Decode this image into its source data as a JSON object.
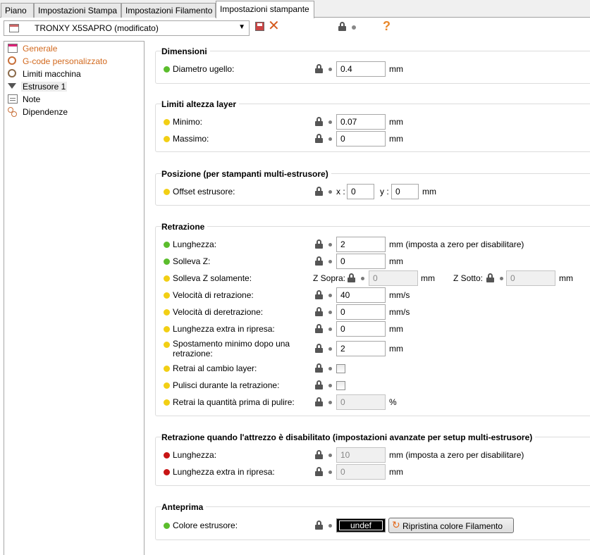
{
  "tabs": [
    "Piano",
    "Impostazioni Stampa",
    "Impostazioni Filamento",
    "Impostazioni stampante"
  ],
  "preset": "TRONXY X5SAPRO (modificato)",
  "toolbar": {
    "save_icon": "save-icon",
    "delete_icon": "delete-icon",
    "help_label": "?"
  },
  "tree": [
    {
      "label": "Generale",
      "icon": "page-icon",
      "color": "#d2691e"
    },
    {
      "label": "G-code personalizzato",
      "icon": "gear-icon",
      "color": "#d2691e"
    },
    {
      "label": "Limiti macchina",
      "icon": "gear-icon",
      "color": "#000000"
    },
    {
      "label": "Estrusore 1",
      "icon": "funnel-icon",
      "color": "#000000",
      "selected": true
    },
    {
      "label": "Note",
      "icon": "note-icon",
      "color": "#000000"
    },
    {
      "label": "Dipendenze",
      "icon": "dependency-icon",
      "color": "#000000"
    }
  ],
  "groups": {
    "dimensioni": {
      "title": "Dimensioni",
      "diametro": {
        "label": "Diametro ugello:",
        "value": "0.4",
        "unit": "mm"
      }
    },
    "limiti": {
      "title": "Limiti altezza layer",
      "minimo": {
        "label": "Minimo:",
        "value": "0.07",
        "unit": "mm"
      },
      "massimo": {
        "label": "Massimo:",
        "value": "0",
        "unit": "mm"
      }
    },
    "posizione": {
      "title": "Posizione (per stampanti multi-estrusore)",
      "offset": {
        "label": "Offset estrusore:",
        "x_label": "x :",
        "x_value": "0",
        "y_label": "y :",
        "y_value": "0",
        "unit": "mm"
      }
    },
    "retrazione": {
      "title": "Retrazione",
      "lunghezza": {
        "label": "Lunghezza:",
        "value": "2",
        "unit": "mm (imposta a zero per disabilitare)"
      },
      "solleva_z": {
        "label": "Solleva Z:",
        "value": "0",
        "unit": "mm"
      },
      "solleva_z_solo": {
        "label": "Solleva Z solamente:",
        "sopra_label": "Z Sopra:",
        "sopra_value": "0",
        "sopra_unit": "mm",
        "sotto_label": "Z Sotto:",
        "sotto_value": "0",
        "sotto_unit": "mm"
      },
      "velocita_retr": {
        "label": "Velocità di retrazione:",
        "value": "40",
        "unit": "mm/s"
      },
      "velocita_deretr": {
        "label": "Velocità di deretrazione:",
        "value": "0",
        "unit": "mm/s"
      },
      "extra_ripresa": {
        "label": "Lunghezza extra in ripresa:",
        "value": "0",
        "unit": "mm"
      },
      "spostamento": {
        "label": "Spostamento minimo dopo una retrazione:",
        "value": "2",
        "unit": "mm"
      },
      "cambio_layer": {
        "label": "Retrai al cambio layer:",
        "checked": false
      },
      "pulisci": {
        "label": "Pulisci durante la retrazione:",
        "checked": false
      },
      "prima_pulire": {
        "label": "Retrai la quantità prima di pulire:",
        "value": "0",
        "unit": "%"
      }
    },
    "retrazione_tool": {
      "title": "Retrazione quando l'attrezzo è disabilitato (impostazioni avanzate per setup multi-estrusore)",
      "lunghezza": {
        "label": "Lunghezza:",
        "value": "10",
        "unit": "mm (imposta a zero per disabilitare)"
      },
      "extra_ripresa": {
        "label": "Lunghezza extra in ripresa:",
        "value": "0",
        "unit": "mm"
      }
    },
    "anteprima": {
      "title": "Anteprima",
      "colore": {
        "label": "Colore estrusore:",
        "swatch": "undef",
        "reset_label": "Ripristina colore Filamento"
      }
    }
  },
  "colors": {
    "green": "#5bbd2c",
    "yellow": "#f2cf14",
    "red": "#c81414",
    "accent": "#d2691e"
  }
}
